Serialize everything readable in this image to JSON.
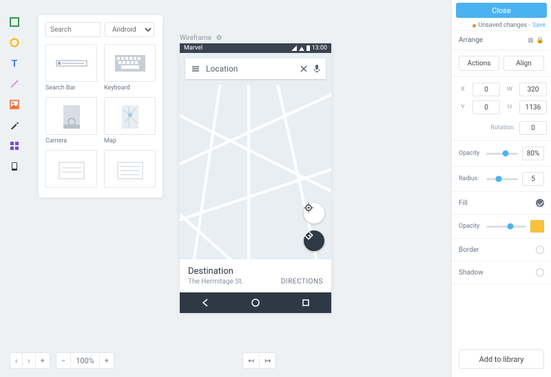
{
  "toolRail": {
    "tools": [
      {
        "name": "rectangle-tool-icon",
        "color": "#2e9a47"
      },
      {
        "name": "circle-tool-icon",
        "color": "#f7b500"
      },
      {
        "name": "text-tool-icon",
        "color": "#3b82f6"
      },
      {
        "name": "line-tool-icon",
        "color": "#f28bd8"
      },
      {
        "name": "image-tool-icon",
        "color": "#f0672b"
      },
      {
        "name": "pen-tool-icon",
        "color": "#303947"
      },
      {
        "name": "components-tool-icon",
        "color": "#7b4dd6"
      },
      {
        "name": "device-tool-icon",
        "color": "#303947"
      }
    ]
  },
  "componentPanel": {
    "searchPlaceholder": "Search",
    "platform": "Android",
    "items": [
      {
        "label": "Search Bar"
      },
      {
        "label": "Keyboard"
      },
      {
        "label": "Camera"
      },
      {
        "label": "Map"
      },
      {
        "label": ""
      },
      {
        "label": ""
      }
    ]
  },
  "canvas": {
    "label": "Wireframe",
    "phone": {
      "title": "Marvel",
      "time": "13:00",
      "searchText": "Location",
      "destination": {
        "title": "Destination",
        "sub": "The Hermitage St.",
        "directions": "DIRECTIONS"
      }
    }
  },
  "inspector": {
    "closeLabel": "Close",
    "unsavedText": "Unsaved changes -",
    "saveLabel": "Save",
    "arrangeLabel": "Arrange",
    "actionsLabel": "Actions",
    "alignLabel": "Align",
    "x": "0",
    "y": "0",
    "w": "320",
    "h": "1136",
    "rotationLabel": "Rotation",
    "rotation": "0",
    "opacityLabel": "Opacity",
    "opacity": "80%",
    "opacitySlider": 60,
    "radiusLabel": "Radius",
    "radius": "5",
    "radiusSlider": 40,
    "fillLabel": "Fill",
    "fillOpacityLabel": "Opacity",
    "fillOpacitySlider": 60,
    "fillColor": "#ffc13b",
    "borderLabel": "Border",
    "shadowLabel": "Shadow",
    "addLibraryLabel": "Add to library"
  },
  "bottom": {
    "zoom": "100%"
  },
  "labels": {
    "X": "X",
    "Y": "Y",
    "W": "W",
    "H": "H"
  }
}
